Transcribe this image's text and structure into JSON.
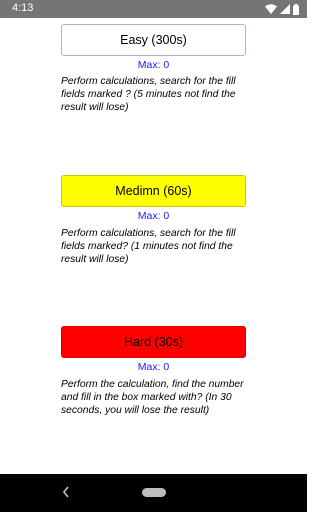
{
  "status_bar": {
    "time": "4:13",
    "icons": [
      "wifi-icon",
      "signal-icon",
      "battery-icon"
    ]
  },
  "levels": {
    "easy": {
      "button_label": "Easy (300s)",
      "max": "Max: 0",
      "description": "Perform calculations, search for the fill fields marked ? (5 minutes not find the result will lose)",
      "color": "#ffffff"
    },
    "medium": {
      "button_label": "Medimn (60s)",
      "max": "Max: 0",
      "description": "Perform calculations, search for the fill fields marked? (1 minutes not find the result will lose)",
      "color": "#ffff00"
    },
    "hard": {
      "button_label": "Hard (30s)",
      "max": "Max: 0",
      "description": "Perform the calculation, find the number and fill in the box marked with? (In 30 seconds, you will lose the result)",
      "color": "#ff0000"
    }
  },
  "colors": {
    "status_bar": "#757575",
    "nav_bar": "#000000",
    "max_text": "#1a1aff"
  },
  "nav_bar": {
    "back_icon": "back-chevron-icon",
    "home_icon": "home-pill-icon"
  }
}
